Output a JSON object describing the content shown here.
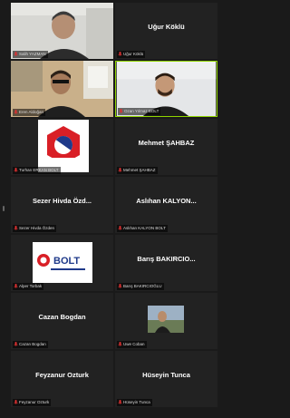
{
  "participants": [
    {
      "display_name": "",
      "caption": "Salih YAZMAN"
    },
    {
      "display_name": "Uğur Köklü",
      "caption": "Uğur Köklü"
    },
    {
      "display_name": "",
      "caption": "Eren Aldoğan"
    },
    {
      "display_name": "",
      "caption": "Ozan Yılmaz BOLT",
      "active_speaker": true
    },
    {
      "display_name": "",
      "caption": "Turhan ERKAN BOLT"
    },
    {
      "display_name": "Mehmet ŞAHBAZ",
      "caption": "Mehmet ŞAHBAZ"
    },
    {
      "display_name": "Sezer Hivda Özd...",
      "caption": "Sezer Hivda Özden"
    },
    {
      "display_name": "Aslıhan KALYON...",
      "caption": "Aslıhan KALYON BOLT"
    },
    {
      "display_name": "",
      "caption": "Alper Torbak"
    },
    {
      "display_name": "Barış BAKIRCIO...",
      "caption": "Barış BAKIRCIOĞLU"
    },
    {
      "display_name": "Cazan Bogdan",
      "caption": "Cazan Bogdan"
    },
    {
      "display_name": "",
      "caption": "Uwe Coban"
    },
    {
      "display_name": "Feyzanur Ozturk",
      "caption": "Feyzanur Ozturk"
    },
    {
      "display_name": "Hüseyin Tunca",
      "caption": "Hüseyin Tunca"
    }
  ],
  "logo": {
    "text": "BOLT"
  },
  "colors": {
    "active_border": "#8fd400",
    "mic_muted": "#e03030",
    "tile_bg": "#222222"
  }
}
